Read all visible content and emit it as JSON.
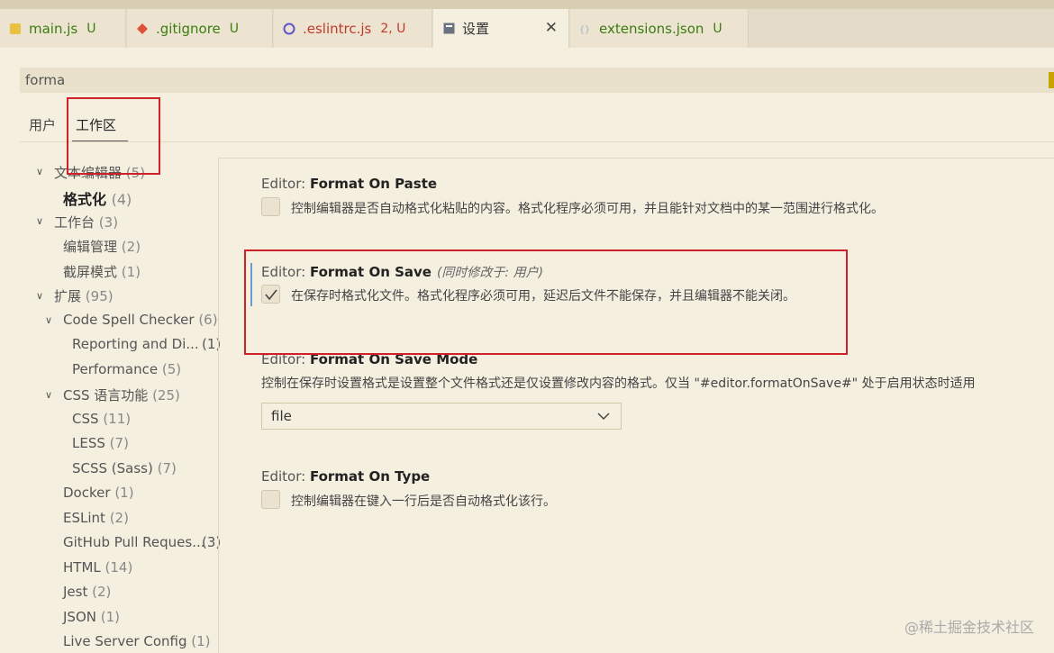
{
  "tabs": [
    {
      "name": "main.js",
      "badge": "U",
      "badge_color": "green",
      "icon": "js-file-icon",
      "active": false
    },
    {
      "name": ".gitignore",
      "badge": "U",
      "badge_color": "green",
      "icon": "git-icon",
      "active": false
    },
    {
      "name": ".eslintrc.js",
      "badge": "2, U",
      "badge_color": "red",
      "icon": "eslint-icon",
      "active": false
    },
    {
      "name": "设置",
      "badge": "",
      "icon": "settings-file-icon",
      "active": true
    },
    {
      "name": "extensions.json",
      "badge": "U",
      "badge_color": "green",
      "icon": "json-file-icon",
      "active": false
    }
  ],
  "search": {
    "value": "forma"
  },
  "scope_tabs": {
    "user": "用户",
    "workspace": "工作区"
  },
  "toc": [
    {
      "label": "文本编辑器",
      "count": "(5)",
      "expanded": true
    },
    {
      "label": "格式化",
      "count": "(4)",
      "selected": true
    },
    {
      "label": "工作台",
      "count": "(3)",
      "expanded": true
    },
    {
      "label": "编辑管理",
      "count": "(2)"
    },
    {
      "label": "截屏模式",
      "count": "(1)"
    },
    {
      "label": "扩展",
      "count": "(95)",
      "expanded": true
    },
    {
      "label": "Code Spell Checker",
      "count": "(6)",
      "expanded": true
    },
    {
      "label": "Reporting and Di...",
      "count": "(1)"
    },
    {
      "label": "Performance",
      "count": "(5)"
    },
    {
      "label": "CSS 语言功能",
      "count": "(25)",
      "expanded": true
    },
    {
      "label": "CSS",
      "count": "(11)"
    },
    {
      "label": "LESS",
      "count": "(7)"
    },
    {
      "label": "SCSS (Sass)",
      "count": "(7)"
    },
    {
      "label": "Docker",
      "count": "(1)"
    },
    {
      "label": "ESLint",
      "count": "(2)"
    },
    {
      "label": "GitHub Pull Reques...",
      "count": "(3)"
    },
    {
      "label": "HTML",
      "count": "(14)"
    },
    {
      "label": "Jest",
      "count": "(2)"
    },
    {
      "label": "JSON",
      "count": "(1)"
    },
    {
      "label": "Live Server Config",
      "count": "(1)"
    }
  ],
  "settings": {
    "format_on_paste": {
      "prefix": "Editor: ",
      "title": "Format On Paste",
      "desc": "控制编辑器是否自动格式化粘贴的内容。格式化程序必须可用，并且能针对文档中的某一范围进行格式化。",
      "checked": false
    },
    "format_on_save": {
      "prefix": "Editor: ",
      "title": "Format On Save",
      "note": "(同时修改于: 用户)",
      "desc": "在保存时格式化文件。格式化程序必须可用，延迟后文件不能保存，并且编辑器不能关闭。",
      "checked": true
    },
    "format_on_save_mode": {
      "prefix": "Editor: ",
      "title": "Format On Save Mode",
      "desc": "控制在保存时设置格式是设置整个文件格式还是仅设置修改内容的格式。仅当 \"#editor.formatOnSave#\" 处于启用状态时适用",
      "value": "file"
    },
    "format_on_type": {
      "prefix": "Editor: ",
      "title": "Format On Type",
      "desc": "控制编辑器在键入一行后是否自动格式化该行。",
      "checked": false
    }
  },
  "watermark": "@稀土掘金技术社区"
}
